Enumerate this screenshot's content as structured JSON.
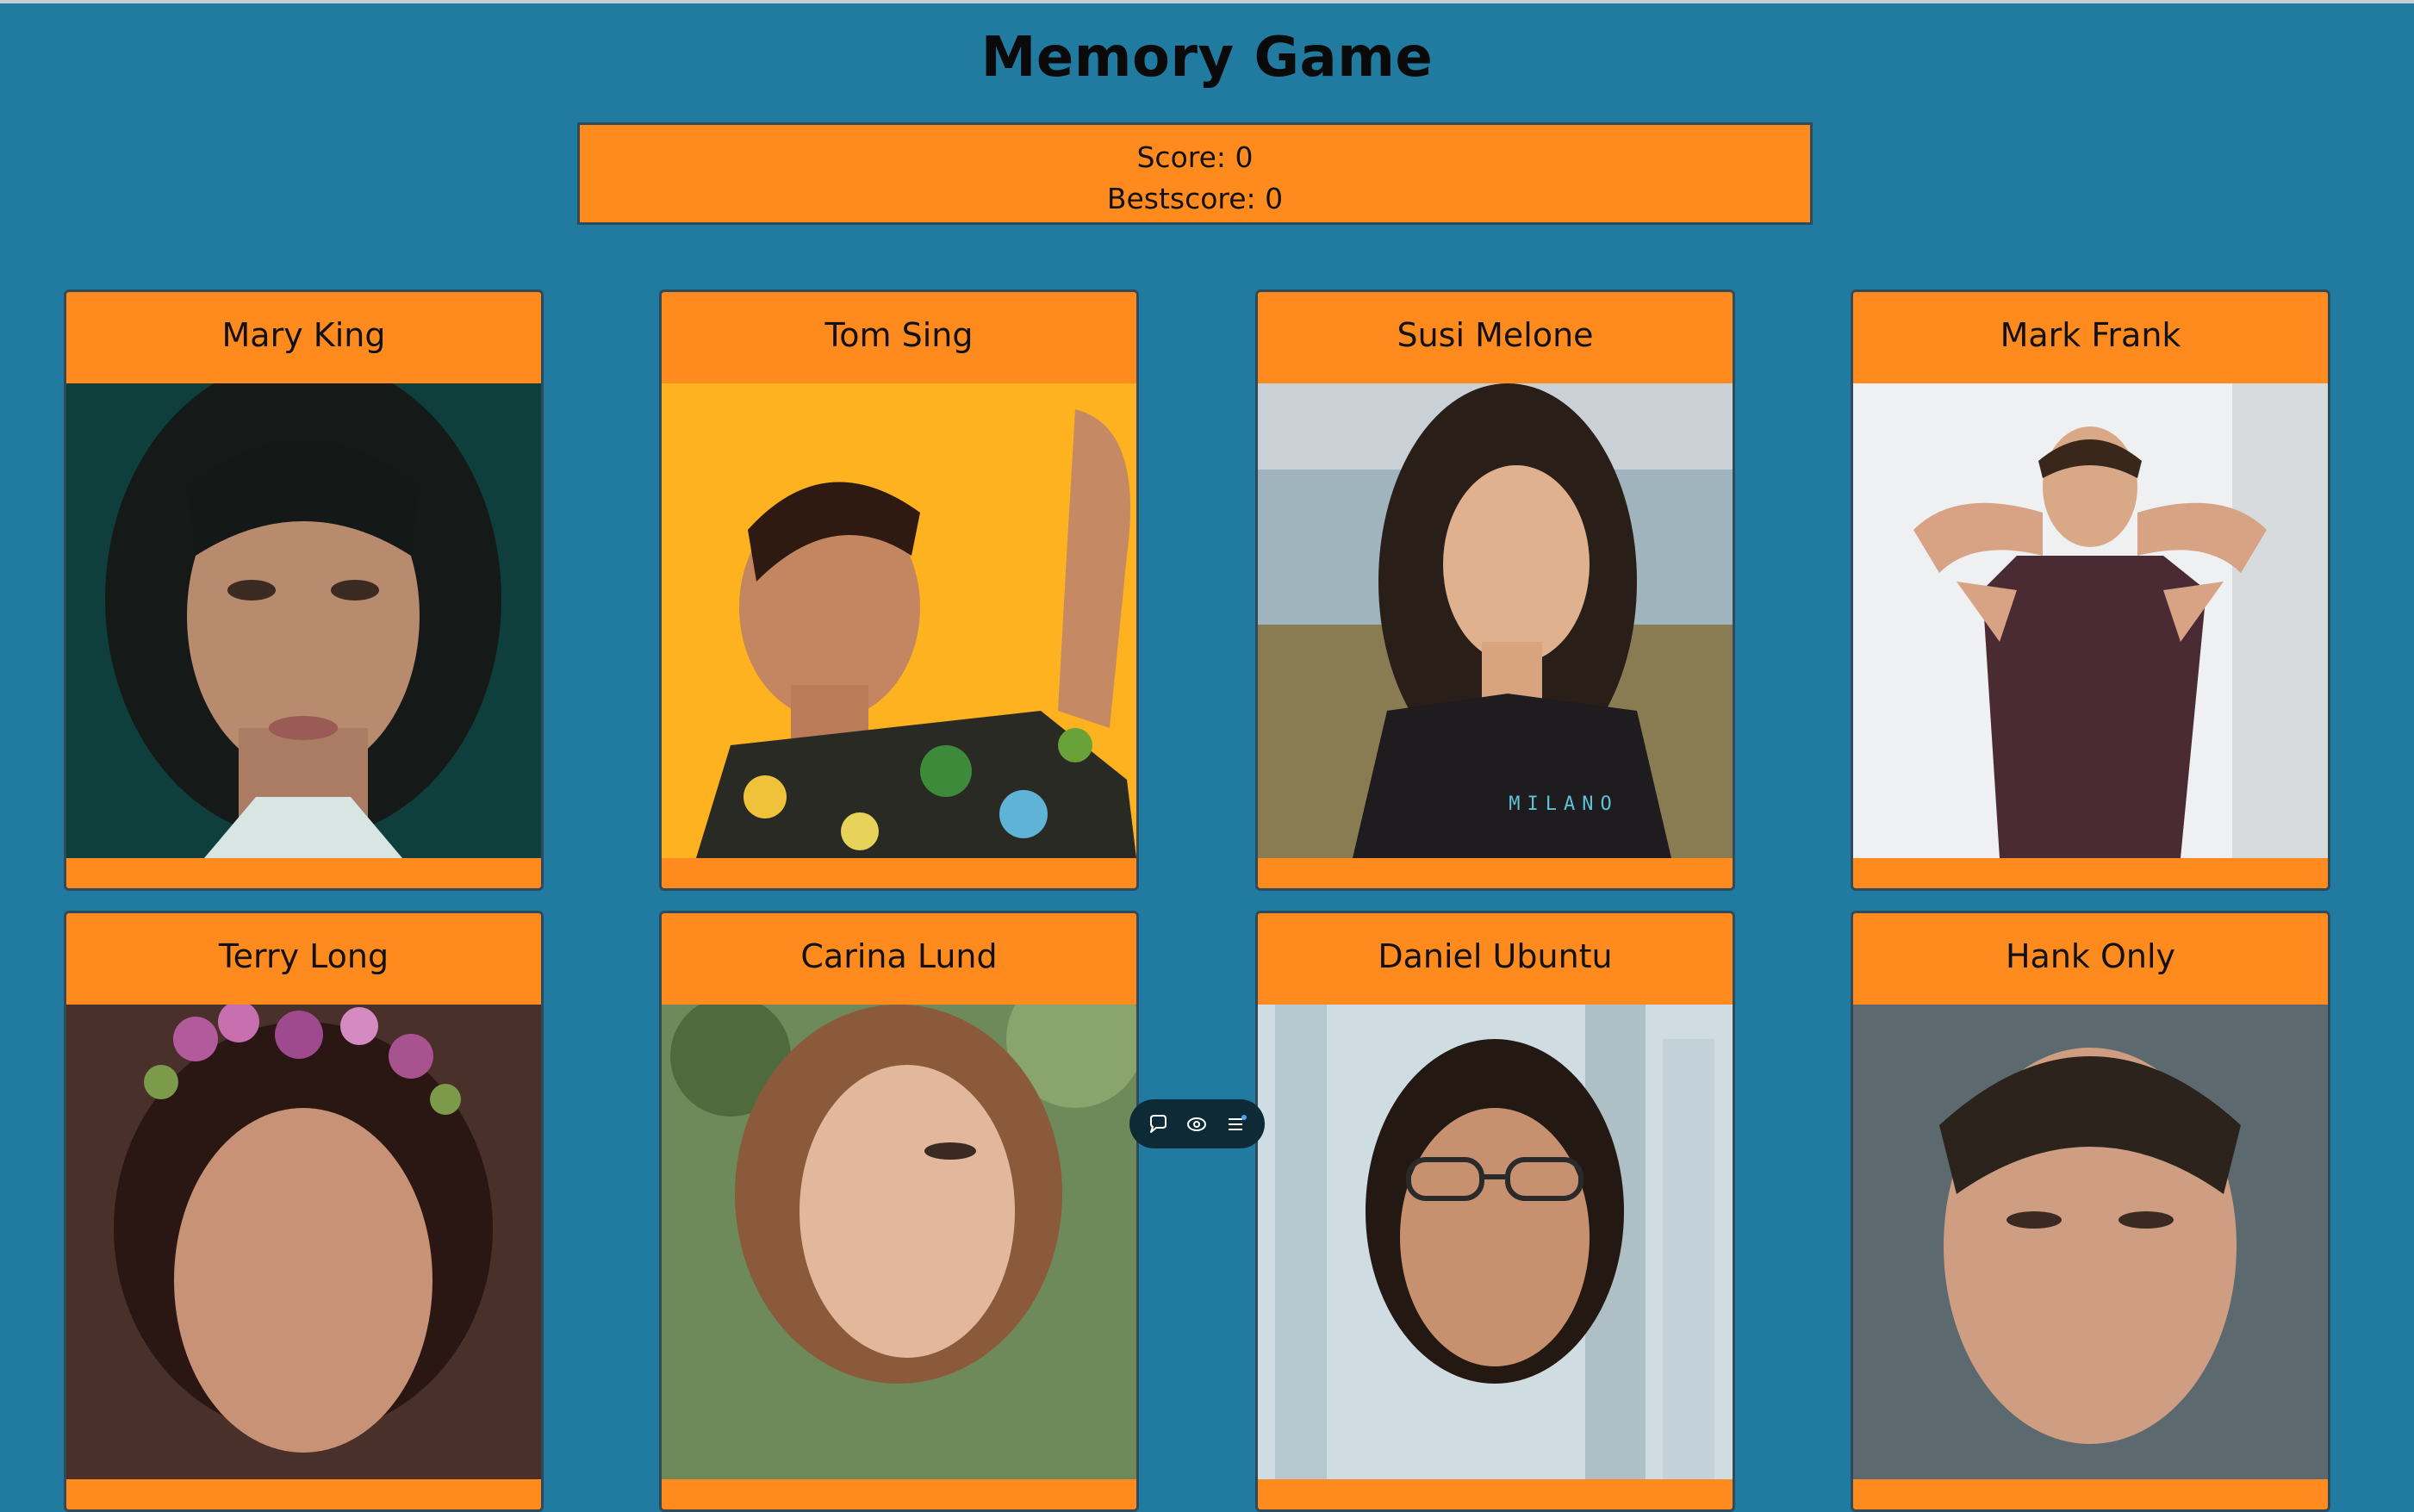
{
  "title": "Memory Game",
  "score": {
    "label": "Score: 0",
    "best_label": "Bestscore: 0"
  },
  "cards": [
    {
      "name": "Mary King"
    },
    {
      "name": "Tom Sing"
    },
    {
      "name": "Susi Melone"
    },
    {
      "name": "Mark Frank"
    },
    {
      "name": "Terry Long"
    },
    {
      "name": "Carina Lund"
    },
    {
      "name": "Daniel Ubuntu"
    },
    {
      "name": "Hank Only"
    }
  ],
  "photo_text": {
    "shirt": "MILANO"
  },
  "colors": {
    "background": "#217aa0",
    "accent": "#ff8a1d",
    "border": "#2f4a5a"
  },
  "toolbar": {
    "icons": [
      "comment-icon",
      "eye-icon",
      "menu-icon"
    ]
  }
}
